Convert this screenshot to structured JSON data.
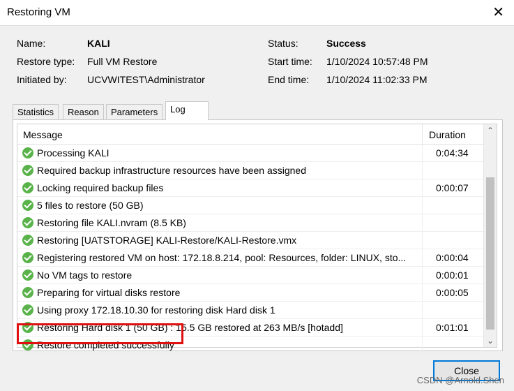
{
  "window": {
    "title": "Restoring VM",
    "close_glyph": "✕"
  },
  "info": {
    "name_label": "Name:",
    "name_value": "KALI",
    "restore_type_label": "Restore type:",
    "restore_type_value": "Full VM Restore",
    "initiated_label": "Initiated by:",
    "initiated_value": "UCVWITEST\\Administrator",
    "status_label": "Status:",
    "status_value": "Success",
    "start_label": "Start time:",
    "start_value": "1/10/2024 10:57:48 PM",
    "end_label": "End time:",
    "end_value": "1/10/2024 11:02:33 PM"
  },
  "tabs": [
    "Statistics",
    "Reason",
    "Parameters",
    "Log"
  ],
  "active_tab": "Log",
  "log": {
    "columns": {
      "message": "Message",
      "duration": "Duration"
    },
    "rows": [
      {
        "message": "Processing KALI",
        "duration": "0:04:34"
      },
      {
        "message": "Required backup infrastructure resources have been assigned",
        "duration": ""
      },
      {
        "message": "Locking required backup files",
        "duration": "0:00:07"
      },
      {
        "message": "5 files to restore (50 GB)",
        "duration": ""
      },
      {
        "message": "Restoring file KALI.nvram (8.5 KB)",
        "duration": ""
      },
      {
        "message": "Restoring [UATSTORAGE] KALI-Restore/KALI-Restore.vmx",
        "duration": ""
      },
      {
        "message": "Registering restored VM on host: 172.18.8.214, pool: Resources, folder: LINUX, sto...",
        "duration": "0:00:04"
      },
      {
        "message": "No VM tags to restore",
        "duration": "0:00:01"
      },
      {
        "message": "Preparing for virtual disks restore",
        "duration": "0:00:05"
      },
      {
        "message": "Using proxy 172.18.10.30 for restoring disk Hard disk 1",
        "duration": ""
      },
      {
        "message": "Restoring Hard disk 1 (50 GB) : 15.5 GB restored at 263 MB/s  [hotadd]",
        "duration": "0:01:01"
      },
      {
        "message": "Restore completed successfully",
        "duration": ""
      }
    ],
    "status_icon": "success-check-icon",
    "status_color": "#59b34a"
  },
  "highlight_color": "#e01010",
  "buttons": {
    "close_label": "Close"
  },
  "watermark": "CSDN @Arnold.Shen"
}
